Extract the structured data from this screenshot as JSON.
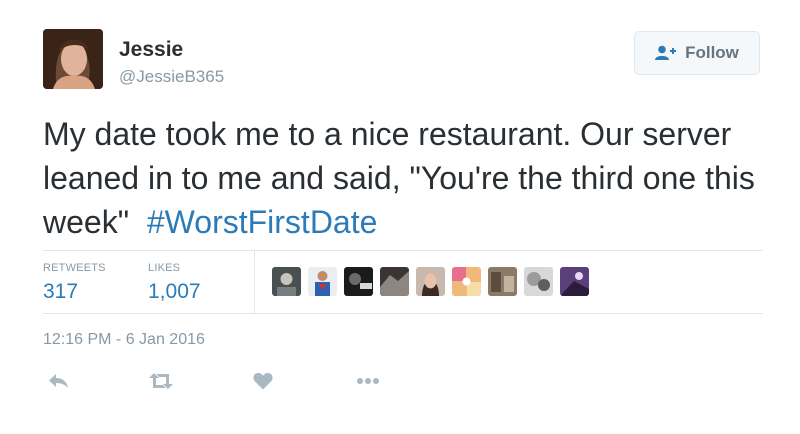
{
  "user": {
    "display_name": "Jessie",
    "handle": "@JessieB365"
  },
  "follow_button": {
    "label": "Follow",
    "icon": "follow-person-icon"
  },
  "tweet": {
    "text": "My date took me to a nice restaurant. Our server leaned in to me and said, \"You're the third one this week\"",
    "hashtag": "#WorstFirstDate"
  },
  "stats": {
    "retweets_label": "RETWEETS",
    "retweets_value": "317",
    "likes_label": "LIKES",
    "likes_value": "1,007"
  },
  "likers_count_shown": 9,
  "timestamp": "12:16 PM - 6 Jan 2016",
  "actions": [
    "reply-icon",
    "retweet-icon",
    "like-icon",
    "more-icon"
  ],
  "colors": {
    "link": "#2b7bb9",
    "muted": "#8899a6",
    "text": "#292f33",
    "action_icon": "#aab8c2",
    "border": "#e1e8ed"
  }
}
